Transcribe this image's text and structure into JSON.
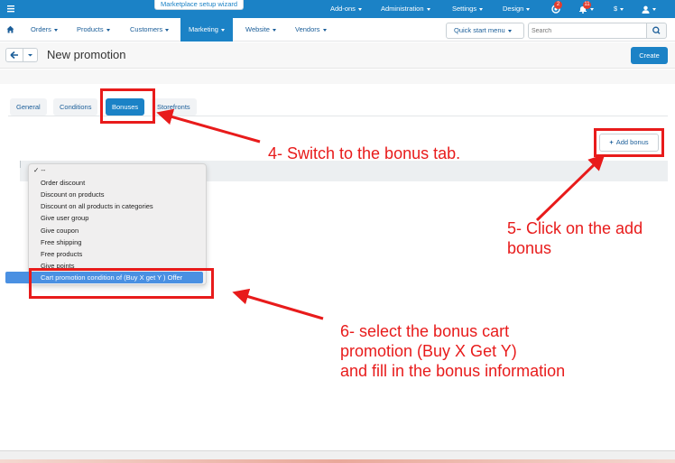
{
  "topbar": {
    "wizard": "Marketplace setup wizard",
    "items": [
      "Add-ons",
      "Administration",
      "Settings",
      "Design"
    ],
    "currency": "$",
    "badges": [
      "2",
      "11"
    ]
  },
  "nav": {
    "items": [
      "Orders",
      "Products",
      "Customers",
      "Marketing",
      "Website",
      "Vendors"
    ],
    "active": "Marketing",
    "quick_start": "Quick start menu",
    "search_placeholder": "Search"
  },
  "header": {
    "title": "New promotion",
    "create": "Create"
  },
  "tabs": [
    "General",
    "Conditions",
    "Bonuses",
    "Storefronts"
  ],
  "active_tab": "Bonuses",
  "add_bonus": "Add bonus",
  "dropdown": {
    "options": [
      "--",
      "Order discount",
      "Discount on products",
      "Discount on all products in categories",
      "Give user group",
      "Give coupon",
      "Free shipping",
      "Free products",
      "Give points",
      "Cart promotion condition of (Buy X get Y ) Offer"
    ],
    "checked": "--",
    "highlighted": "Cart promotion condition of (Buy X get Y ) Offer"
  },
  "annotations": {
    "step4": "4- Switch to the bonus tab.",
    "step5_line1": "5- Click on the add",
    "step5_line2": "bonus",
    "step6_line1": "6- select the bonus cart",
    "step6_line2": "promotion (Buy X Get Y)",
    "step6_line3": "and fill in the bonus information"
  },
  "colors": {
    "primary": "#1b82c6",
    "annotation": "#e81b1b",
    "selection": "#4a90e2"
  }
}
